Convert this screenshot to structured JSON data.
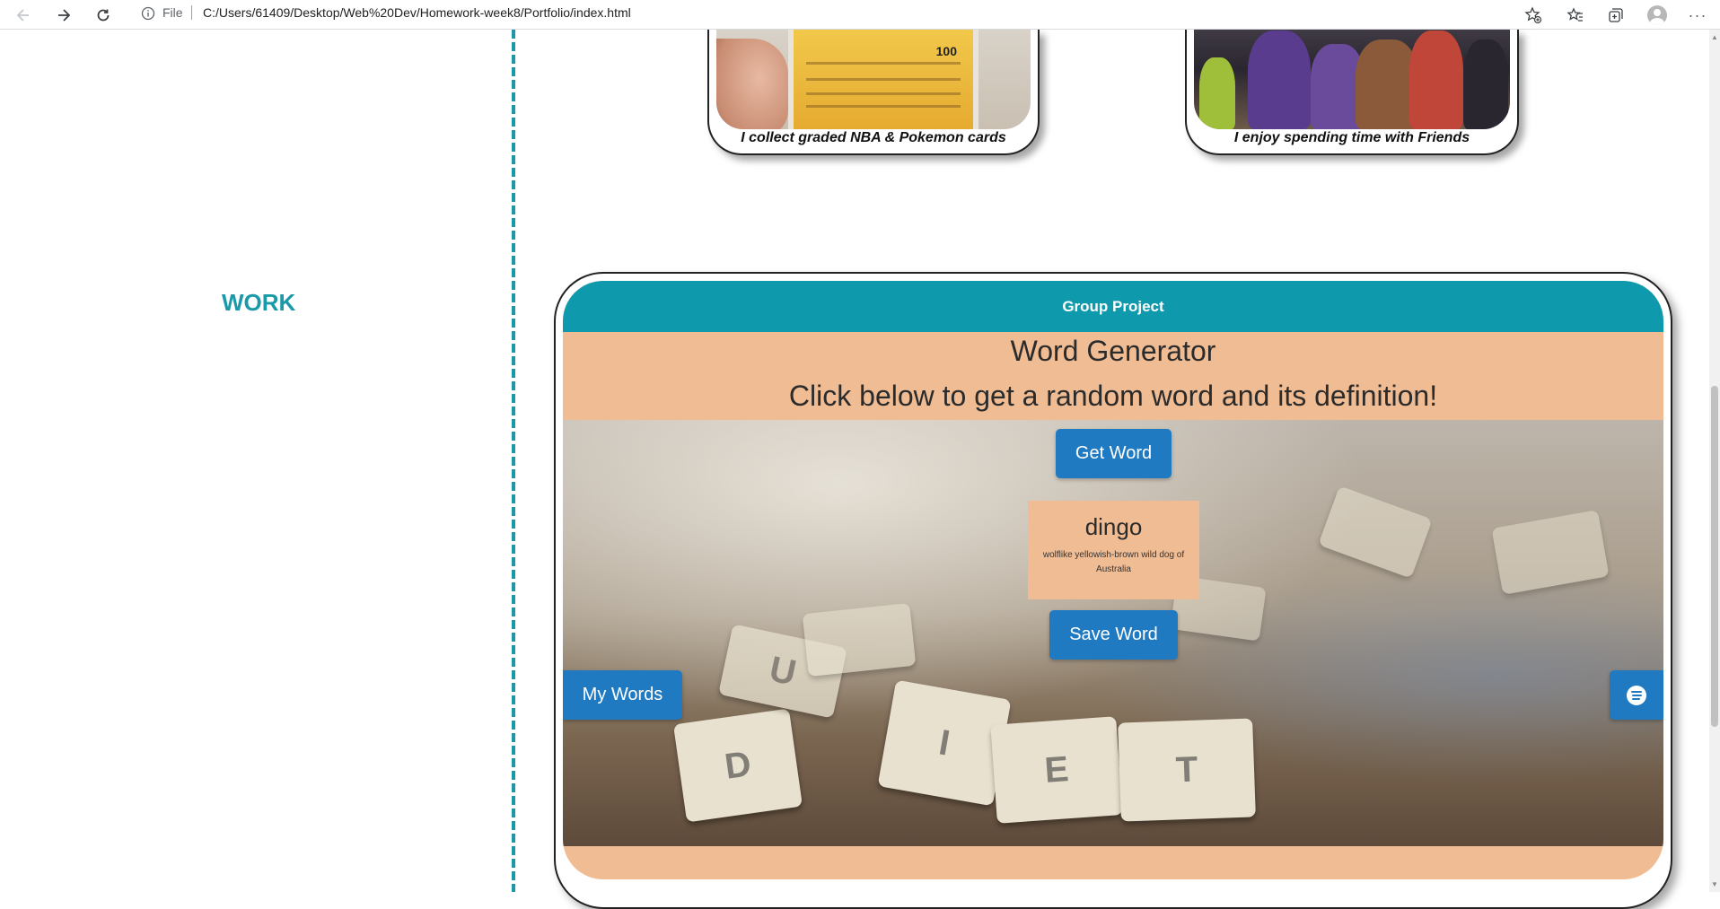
{
  "browser": {
    "file_label": "File",
    "url": "C:/Users/61409/Desktop/Web%20Dev/Homework-week8/Portfolio/index.html",
    "icons": [
      "back-icon",
      "forward-icon",
      "reload-icon",
      "info-icon",
      "add-favorite-icon",
      "favorites-icon",
      "collections-icon",
      "profile-icon",
      "more-icon"
    ],
    "more_glyph": "···"
  },
  "about": {
    "cards": [
      {
        "caption": "I collect graded NBA & Pokemon cards"
      },
      {
        "caption": "I enjoy spending time with Friends"
      }
    ],
    "slab_value": "100"
  },
  "work": {
    "label": "WORK",
    "project": {
      "header": "Group Project",
      "title": "Word Generator",
      "subtitle": "Click below to get a random word and its definition!",
      "get_word_label": "Get Word",
      "word": "dingo",
      "definition": "wolflike yellowish-brown wild dog of Australia",
      "save_word_label": "Save Word",
      "my_words_label": "My Words",
      "spotify_icon": "spotify-icon"
    }
  },
  "colors": {
    "accent_teal": "#1a9aa8",
    "header_teal": "#0e9aac",
    "peach": "#f0bc94",
    "button_blue": "#1f7ac2"
  }
}
